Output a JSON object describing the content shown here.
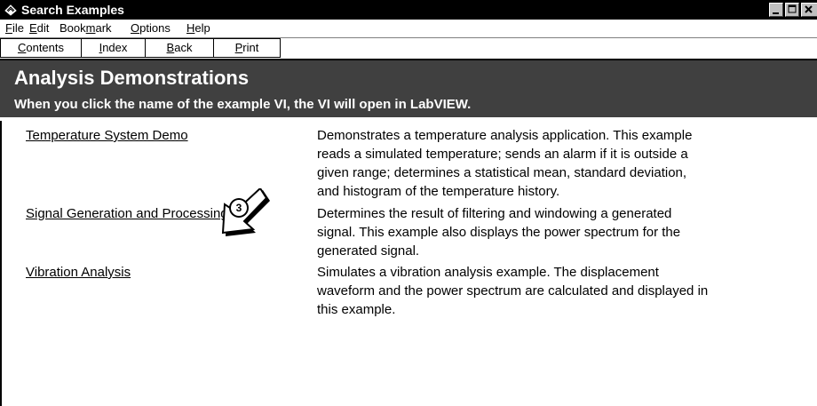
{
  "window": {
    "title": "Search Examples"
  },
  "menu": [
    {
      "pre": "",
      "key": "F",
      "post": "ile"
    },
    {
      "pre": "",
      "key": "E",
      "post": "dit"
    },
    {
      "pre": "Book",
      "key": "m",
      "post": "ark"
    },
    {
      "pre": "",
      "key": "O",
      "post": "ptions"
    },
    {
      "pre": "",
      "key": "H",
      "post": "elp"
    }
  ],
  "buttons": [
    {
      "pre": "",
      "key": "C",
      "post": "ontents"
    },
    {
      "pre": "",
      "key": "I",
      "post": "ndex"
    },
    {
      "pre": "",
      "key": "B",
      "post": "ack"
    },
    {
      "pre": "",
      "key": "P",
      "post": "rint"
    }
  ],
  "banner": {
    "title": "Analysis Demonstrations",
    "subtitle": "When you click the name of the example VI, the VI will open in LabVIEW."
  },
  "examples": [
    {
      "name": "Temperature System Demo",
      "lines": [
        "Demonstrates a temperature analysis application.  This example",
        "reads a simulated temperature; sends an alarm if it is outside a",
        "given range; determines a statistical mean, standard deviation,",
        "and histogram of the temperature history."
      ]
    },
    {
      "name": "Signal Generation and Processing",
      "lines": [
        "Determines the result of filtering and windowing a generated",
        "signal.  This example also displays the power spectrum for the",
        "generated signal."
      ]
    },
    {
      "name": "Vibration Analysis",
      "lines": [
        "Simulates a vibration analysis example.  The displacement",
        "waveform and the power spectrum are calculated and displayed in",
        "this example."
      ]
    }
  ],
  "callout": {
    "number": "3"
  }
}
